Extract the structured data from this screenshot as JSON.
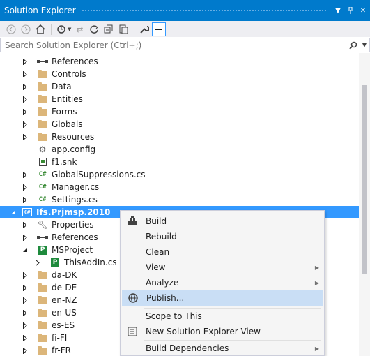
{
  "window": {
    "title": "Solution Explorer"
  },
  "search": {
    "placeholder": "Search Solution Explorer (Ctrl+;)"
  },
  "tree": [
    {
      "label": "References",
      "icon": "references-icon"
    },
    {
      "label": "Controls",
      "icon": "folder-icon"
    },
    {
      "label": "Data",
      "icon": "folder-icon"
    },
    {
      "label": "Entities",
      "icon": "folder-icon"
    },
    {
      "label": "Forms",
      "icon": "folder-icon"
    },
    {
      "label": "Globals",
      "icon": "folder-icon"
    },
    {
      "label": "Resources",
      "icon": "folder-icon"
    },
    {
      "label": "app.config",
      "icon": "config-file-icon"
    },
    {
      "label": "f1.snk",
      "icon": "key-file-icon"
    },
    {
      "label": "GlobalSuppressions.cs",
      "icon": "csharp-file-icon"
    },
    {
      "label": "Manager.cs",
      "icon": "csharp-file-icon"
    },
    {
      "label": "Settings.cs",
      "icon": "csharp-file-icon"
    },
    {
      "label": "Ifs.Prjmsp.2010",
      "icon": "csharp-project-icon"
    },
    {
      "label": "Properties",
      "icon": "wrench-icon"
    },
    {
      "label": "References",
      "icon": "references-icon"
    },
    {
      "label": "MSProject",
      "icon": "msproject-icon"
    },
    {
      "label": "ThisAddIn.cs",
      "icon": "msproject-icon"
    },
    {
      "label": "da-DK",
      "icon": "folder-icon"
    },
    {
      "label": "de-DE",
      "icon": "folder-icon"
    },
    {
      "label": "en-NZ",
      "icon": "folder-icon"
    },
    {
      "label": "en-US",
      "icon": "folder-icon"
    },
    {
      "label": "es-ES",
      "icon": "folder-icon"
    },
    {
      "label": "fi-FI",
      "icon": "folder-icon"
    },
    {
      "label": "fr-FR",
      "icon": "folder-icon"
    }
  ],
  "context_menu": [
    {
      "label": "Build",
      "icon": "build-icon"
    },
    {
      "label": "Rebuild"
    },
    {
      "label": "Clean"
    },
    {
      "label": "View",
      "submenu": true
    },
    {
      "label": "Analyze",
      "submenu": true
    },
    {
      "label": "Publish...",
      "icon": "publish-icon",
      "highlighted": true
    },
    {
      "label": "Scope to This"
    },
    {
      "label": "New Solution Explorer View",
      "icon": "new-view-icon"
    },
    {
      "label": "Build Dependencies",
      "submenu": true
    }
  ],
  "colors": {
    "accent": "#007acc",
    "selection": "#3399ff",
    "menu_highlight": "#c9def5",
    "folder": "#dcb67a"
  }
}
